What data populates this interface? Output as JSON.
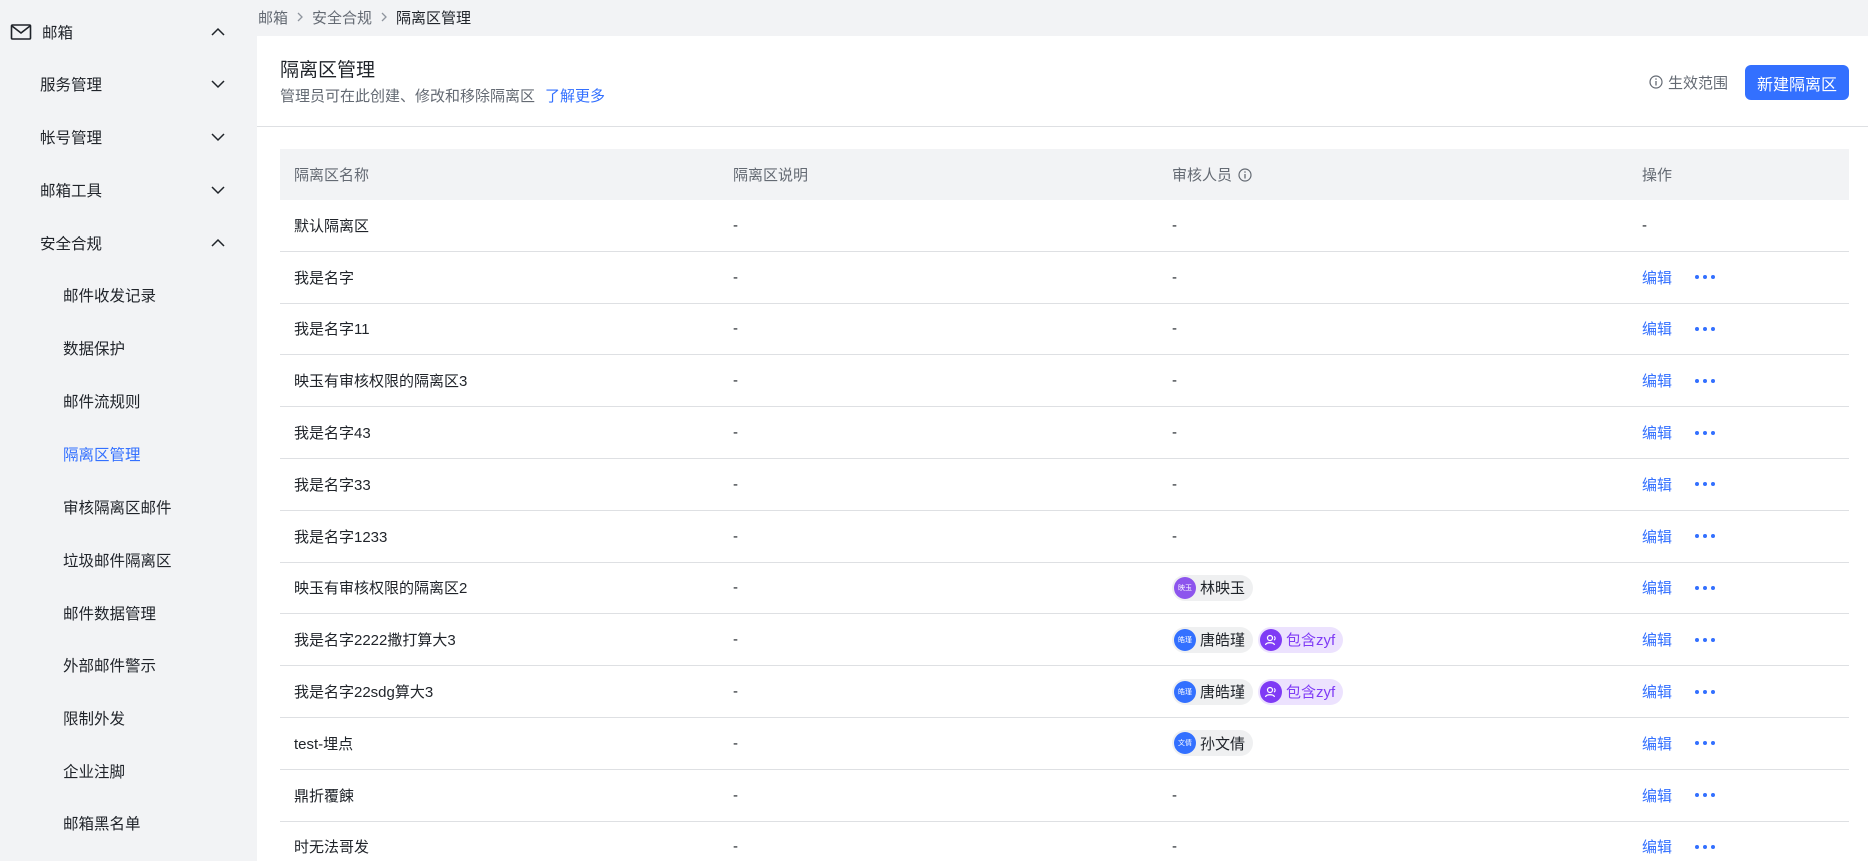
{
  "sidebar": {
    "top": {
      "label": "邮箱",
      "icon": "mail-icon"
    },
    "sections": [
      {
        "label": "服务管理",
        "expanded": false
      },
      {
        "label": "帐号管理",
        "expanded": false
      },
      {
        "label": "邮箱工具",
        "expanded": false
      },
      {
        "label": "安全合规",
        "expanded": true
      }
    ],
    "sub_items": [
      {
        "label": "邮件收发记录",
        "active": false
      },
      {
        "label": "数据保护",
        "active": false
      },
      {
        "label": "邮件流规则",
        "active": false
      },
      {
        "label": "隔离区管理",
        "active": true
      },
      {
        "label": "审核隔离区邮件",
        "active": false
      },
      {
        "label": "垃圾邮件隔离区",
        "active": false
      },
      {
        "label": "邮件数据管理",
        "active": false
      },
      {
        "label": "外部邮件警示",
        "active": false
      },
      {
        "label": "限制外发",
        "active": false
      },
      {
        "label": "企业注脚",
        "active": false
      },
      {
        "label": "邮箱黑名单",
        "active": false
      }
    ]
  },
  "breadcrumb": [
    "邮箱",
    "安全合规",
    "隔离区管理"
  ],
  "header": {
    "title": "隔离区管理",
    "description": "管理员可在此创建、修改和移除隔离区",
    "learn_more": "了解更多",
    "scope_label": "生效范围",
    "new_button": "新建隔离区"
  },
  "table": {
    "columns": [
      "隔离区名称",
      "隔离区说明",
      "审核人员",
      "操作"
    ],
    "edit_label": "编辑",
    "rows": [
      {
        "name": "默认隔离区",
        "desc": "-",
        "reviewers": [],
        "reviewers_text": "-",
        "action_text": "-",
        "editable": false
      },
      {
        "name": "我是名字",
        "desc": "-",
        "reviewers": [],
        "reviewers_text": "-",
        "editable": true
      },
      {
        "name": "我是名字11",
        "desc": "-",
        "reviewers": [],
        "reviewers_text": "-",
        "editable": true
      },
      {
        "name": "映玉有审核权限的隔离区3",
        "desc": "-",
        "reviewers": [],
        "reviewers_text": "-",
        "editable": true
      },
      {
        "name": "我是名字43",
        "desc": "-",
        "reviewers": [],
        "reviewers_text": "-",
        "editable": true
      },
      {
        "name": "我是名字33",
        "desc": "-",
        "reviewers": [],
        "reviewers_text": "-",
        "editable": true
      },
      {
        "name": "我是名字1233",
        "desc": "-",
        "reviewers": [],
        "reviewers_text": "-",
        "editable": true
      },
      {
        "name": "映玉有审核权限的隔离区2",
        "desc": "-",
        "reviewers": [
          {
            "type": "user",
            "avatar_text": "映玉",
            "name": "林映玉",
            "color": "purple"
          }
        ],
        "reviewers_text": "",
        "editable": true
      },
      {
        "name": "我是名字2222撒打算大3",
        "desc": "-",
        "reviewers": [
          {
            "type": "user",
            "avatar_text": "皓瑾",
            "name": "唐皓瑾",
            "color": "blue"
          },
          {
            "type": "group",
            "name": "包含zyf"
          }
        ],
        "reviewers_text": "",
        "editable": true
      },
      {
        "name": "我是名字22sdg算大3",
        "desc": "-",
        "reviewers": [
          {
            "type": "user",
            "avatar_text": "皓瑾",
            "name": "唐皓瑾",
            "color": "blue"
          },
          {
            "type": "group",
            "name": "包含zyf"
          }
        ],
        "reviewers_text": "",
        "editable": true
      },
      {
        "name": "test-埋点",
        "desc": "-",
        "reviewers": [
          {
            "type": "user",
            "avatar_text": "文倩",
            "name": "孙文倩",
            "color": "blue"
          }
        ],
        "reviewers_text": "",
        "editable": true
      },
      {
        "name": "鼎折覆餗",
        "desc": "-",
        "reviewers": [],
        "reviewers_text": "-",
        "editable": true
      },
      {
        "name": "时无法哥发",
        "desc": "-",
        "reviewers": [],
        "reviewers_text": "-",
        "editable": true
      }
    ]
  },
  "colors": {
    "accent": "#3370ff",
    "group_chip_bg": "#ece2fe",
    "group_chip_text": "#7f3bf5"
  }
}
